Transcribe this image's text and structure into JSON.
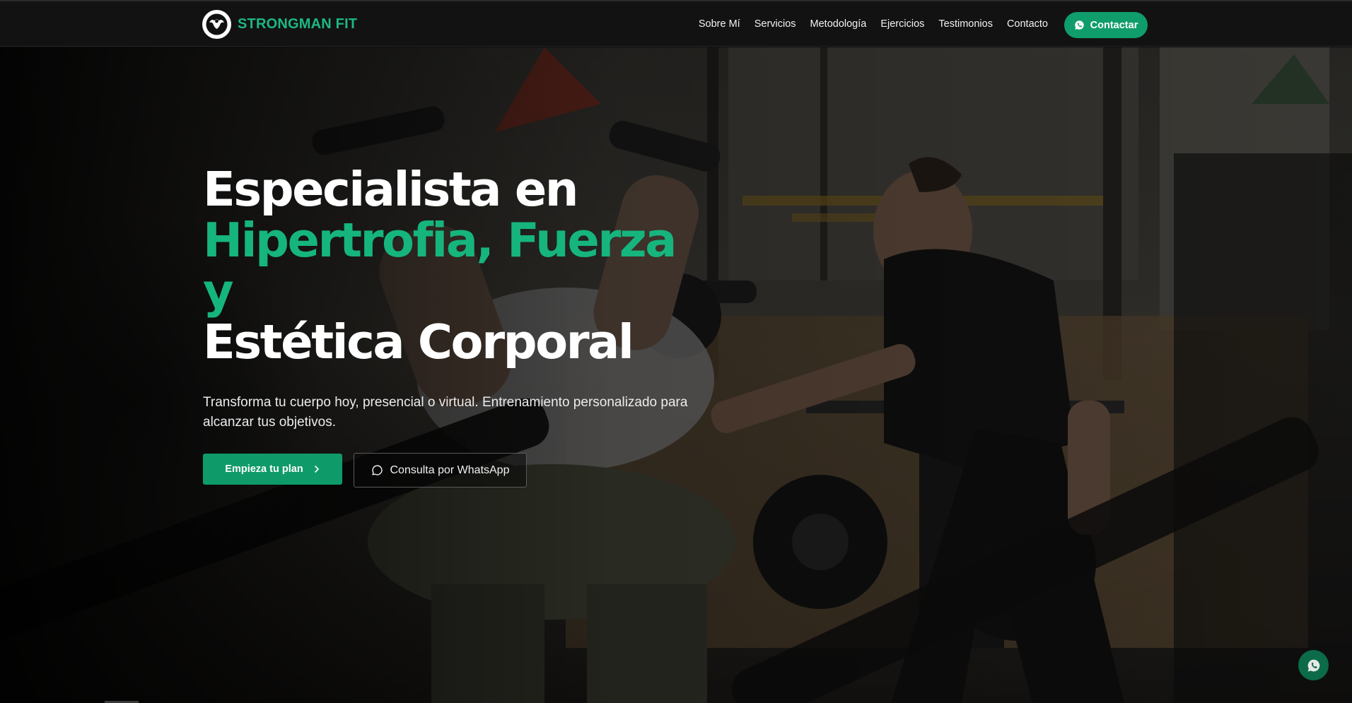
{
  "header": {
    "brand_name": "STRONGMAN FIT",
    "nav": [
      {
        "label": "Sobre Mí"
      },
      {
        "label": "Servicios"
      },
      {
        "label": "Metodología"
      },
      {
        "label": "Ejercicios"
      },
      {
        "label": "Testimonios"
      },
      {
        "label": "Contacto"
      }
    ],
    "cta_label": "Contactar",
    "cta_icon": "whatsapp-icon"
  },
  "hero": {
    "headline_line1": "Especialista en",
    "headline_accent_line1": "Hipertrofia, Fuerza",
    "headline_accent_line2": "y",
    "headline_line4": "Estética Corporal",
    "subtitle": "Transforma tu cuerpo hoy, presencial o virtual. Entrenamiento personalizado para alcanzar tus objetivos.",
    "primary_button": "Empieza tu plan",
    "primary_button_icon": "chevron-right-icon",
    "secondary_button": "Consulta por WhatsApp",
    "secondary_button_icon": "chat-bubble-icon",
    "background": "gym-training-photo"
  },
  "floating_button": {
    "icon": "whatsapp-icon"
  },
  "colors": {
    "accent": "#16b57e",
    "button_green": "#0f9b69",
    "header_bg": "#121212",
    "floating_button": "#0c6b49"
  }
}
